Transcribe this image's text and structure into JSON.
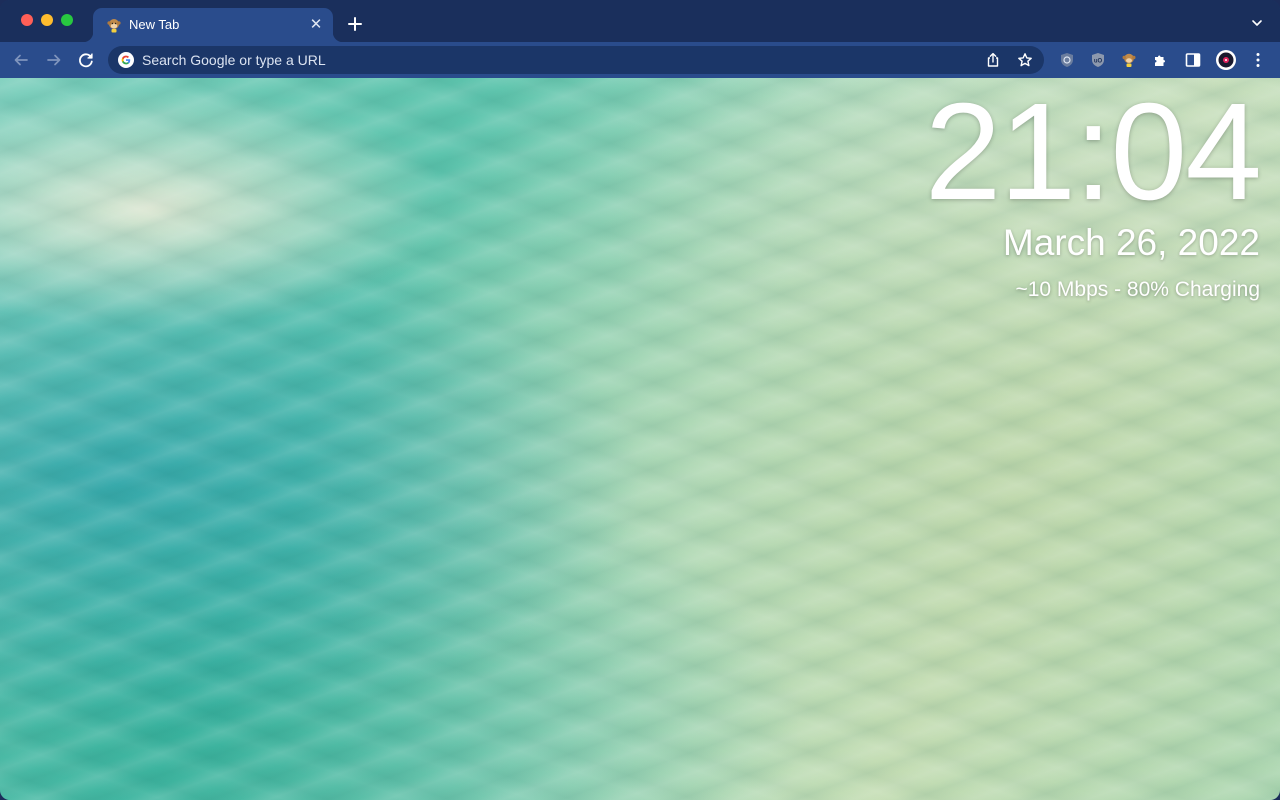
{
  "tab": {
    "title": "New Tab",
    "favicon_icon": "monkey-emoji-icon",
    "close_icon": "close-icon"
  },
  "toolbar": {
    "back_icon": "arrow-left-icon",
    "forward_icon": "arrow-right-icon",
    "reload_icon": "reload-icon",
    "omnibox_placeholder": "Search Google or type a URL",
    "share_icon": "share-icon",
    "bookmark_icon": "star-icon",
    "extensions": [
      "ublock-like-icon",
      "ublock-origin-icon",
      "monkey-extension-icon",
      "puzzle-icon"
    ],
    "side_panel_icon": "side-panel-icon",
    "profile_icon": "profile-avatar-icon",
    "menu_icon": "kebab-menu-icon"
  },
  "newtab": {
    "time": "21:04",
    "date": "March 26, 2022",
    "status": "~10 Mbps - 80% Charging"
  },
  "colors": {
    "tabstrip": "#1a2f5c",
    "toolbar": "#2a4c8c",
    "omnibox": "#1b3668"
  }
}
